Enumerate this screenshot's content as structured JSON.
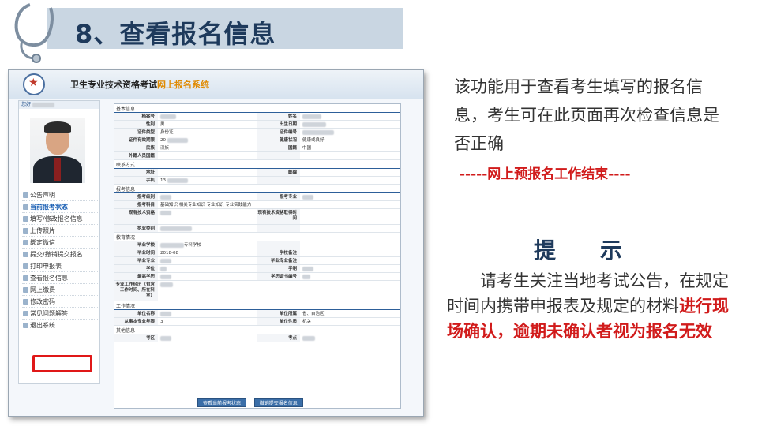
{
  "slide": {
    "title": "8、查看报名信息",
    "intro": "该功能用于查看考生填写的报名信息，考生可在此页面再次检查信息是否正确",
    "ended": "-----网上预报名工作结束----",
    "tip_heading": "提示",
    "tip_normal": "请考生关注当地考试公告，在规定时间内携带申报表及规定的材料",
    "tip_red": "进行现场确认，逾期未确认者视为报名无效"
  },
  "screenshot": {
    "header_title": "卫生专业技术资格考试",
    "header_subtitle": "网上报名系统",
    "greeting": "您好",
    "menu": [
      {
        "label": "公告声明"
      },
      {
        "label": "当前报考状态"
      },
      {
        "label": "填写/修改报名信息"
      },
      {
        "label": "上传照片"
      },
      {
        "label": "绑定微信"
      },
      {
        "label": "提交/撤销提交报名"
      },
      {
        "label": "打印申报表"
      },
      {
        "label": "查看报名信息"
      },
      {
        "label": "网上缴费"
      },
      {
        "label": "修改密码"
      },
      {
        "label": "常见问题解答"
      },
      {
        "label": "退出系统"
      }
    ],
    "sections": {
      "basic": "基本信息",
      "contact": "联系方式",
      "exam": "报考信息",
      "edu": "教育情况",
      "work": "工作情况",
      "other": "其他信息"
    },
    "fields": {
      "file_no": "档案号",
      "name": "姓名",
      "gender": "性别",
      "gender_val": "男",
      "birth": "出生日期",
      "id_type": "证件类型",
      "id_type_val": "身份证",
      "id_no": "证件编号",
      "id_valid": "证件有效期限",
      "id_valid_val": "20",
      "health": "健康状况",
      "health_val": "健康或良好",
      "nation": "民族",
      "nation_val": "汉族",
      "country": "国籍",
      "country_val": "中国",
      "foreign": "外籍人员国籍",
      "address": "地址",
      "postcode": "邮编",
      "mobile": "手机",
      "mobile_val": "13",
      "level": "报考级别",
      "major": "报考专业",
      "subjects": "报考科目",
      "subjects_val": "基础知识  相关专业知识  专业知识  专业实践能力",
      "cur_title": "现有技术资格",
      "cur_title_date": "现有技术资格取得时间",
      "practice": "执业类别",
      "school": "毕业学校",
      "school_val": "专科学校",
      "grad_time": "毕业时间",
      "grad_time_val": "2018-08",
      "school_note": "学校备注",
      "grad_major": "毕业专业",
      "major_note": "毕业专业备注",
      "degree": "学位",
      "discipline": "学制",
      "edu_level": "最高学历",
      "cert_no": "学历证书编号",
      "work_exp": "专业工作经历（包含工作时间、所在科室）",
      "unit": "单位名称",
      "unit_loc": "单位所属",
      "unit_loc_val": "省、自治区",
      "years": "从事本专业年限",
      "years_val": "3",
      "unit_type": "单位性质",
      "unit_type_val": "机关",
      "region": "考区",
      "site": "考点"
    },
    "buttons": {
      "status": "查看当前报考状态",
      "cancel": "撤销提交报名信息"
    }
  }
}
